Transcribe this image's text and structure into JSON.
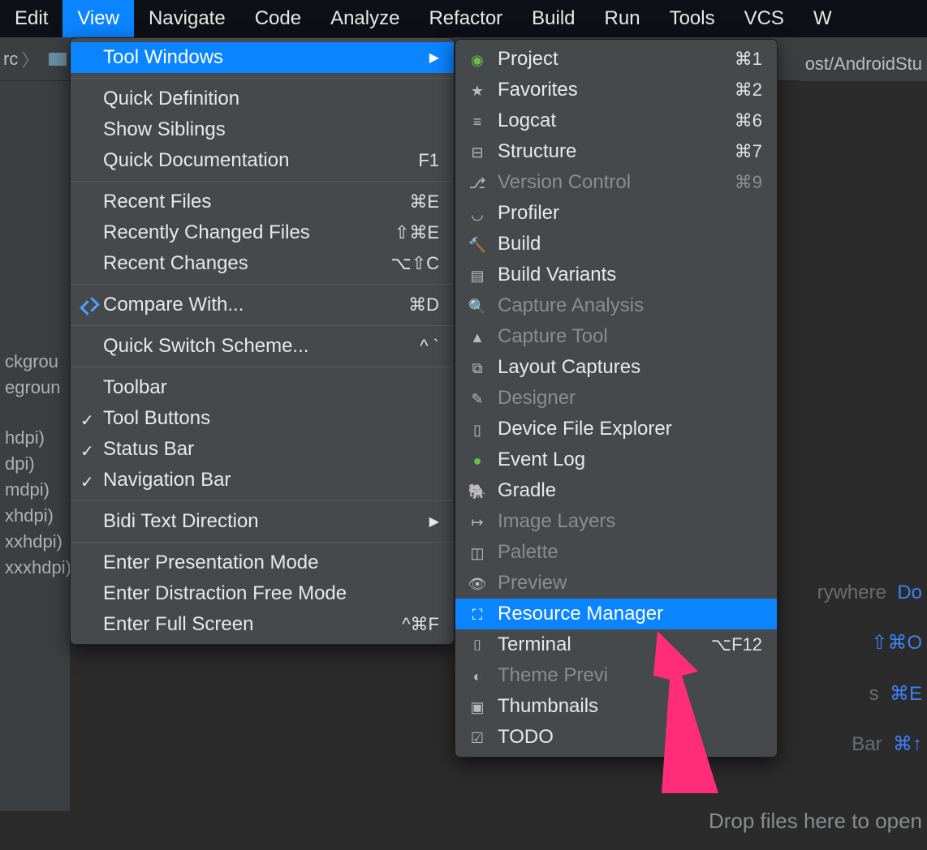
{
  "menubar": {
    "items": [
      "Edit",
      "View",
      "Navigate",
      "Code",
      "Analyze",
      "Refactor",
      "Build",
      "Run",
      "Tools",
      "VCS",
      "W"
    ],
    "active_index": 1
  },
  "breadcrumb": {
    "left": "rc",
    "folder": ""
  },
  "path_right": "ost/AndroidStu",
  "view_menu": {
    "tool_windows": {
      "label": "Tool Windows"
    },
    "quick_definition": {
      "label": "Quick Definition"
    },
    "show_siblings": {
      "label": "Show Siblings"
    },
    "quick_documentation": {
      "label": "Quick Documentation",
      "shortcut": "F1"
    },
    "recent_files": {
      "label": "Recent Files",
      "shortcut": "⌘E"
    },
    "recently_changed_files": {
      "label": "Recently Changed Files",
      "shortcut": "⇧⌘E"
    },
    "recent_changes": {
      "label": "Recent Changes",
      "shortcut": "⌥⇧C"
    },
    "compare_with": {
      "label": "Compare With...",
      "shortcut": "⌘D"
    },
    "quick_switch_scheme": {
      "label": "Quick Switch Scheme...",
      "shortcut": "^ `"
    },
    "toolbar": {
      "label": "Toolbar",
      "checked": false
    },
    "tool_buttons": {
      "label": "Tool Buttons",
      "checked": true
    },
    "status_bar": {
      "label": "Status Bar",
      "checked": true
    },
    "navigation_bar": {
      "label": "Navigation Bar",
      "checked": true
    },
    "bidi": {
      "label": "Bidi Text Direction"
    },
    "enter_presentation": {
      "label": "Enter Presentation Mode"
    },
    "enter_distraction_free": {
      "label": "Enter Distraction Free Mode"
    },
    "enter_full_screen": {
      "label": "Enter Full Screen",
      "shortcut": "^⌘F"
    }
  },
  "tool_windows_menu": {
    "project": {
      "label": "Project",
      "shortcut": "⌘1",
      "icon": "project-icon"
    },
    "favorites": {
      "label": "Favorites",
      "shortcut": "⌘2",
      "icon": "star-icon"
    },
    "logcat": {
      "label": "Logcat",
      "shortcut": "⌘6",
      "icon": "logcat-icon"
    },
    "structure": {
      "label": "Structure",
      "shortcut": "⌘7",
      "icon": "structure-icon"
    },
    "version_control": {
      "label": "Version Control",
      "shortcut": "⌘9",
      "icon": "vcs-icon",
      "disabled": true
    },
    "profiler": {
      "label": "Profiler",
      "icon": "profiler-icon"
    },
    "build": {
      "label": "Build",
      "icon": "hammer-icon"
    },
    "build_variants": {
      "label": "Build Variants",
      "icon": "variants-icon"
    },
    "capture_analysis": {
      "label": "Capture Analysis",
      "icon": "search-icon",
      "disabled": true
    },
    "capture_tool": {
      "label": "Capture Tool",
      "icon": "warning-icon",
      "disabled": true
    },
    "layout_captures": {
      "label": "Layout Captures",
      "icon": "layers-icon"
    },
    "designer": {
      "label": "Designer",
      "icon": "designer-icon",
      "disabled": true
    },
    "device_file_explorer": {
      "label": "Device File Explorer",
      "icon": "device-icon"
    },
    "event_log": {
      "label": "Event Log",
      "icon": "bubble-icon"
    },
    "gradle": {
      "label": "Gradle",
      "icon": "gradle-icon"
    },
    "image_layers": {
      "label": "Image Layers",
      "icon": "image-layers-icon",
      "disabled": true
    },
    "palette": {
      "label": "Palette",
      "icon": "palette-icon",
      "disabled": true
    },
    "preview": {
      "label": "Preview",
      "icon": "eye-icon",
      "disabled": true
    },
    "resource_manager": {
      "label": "Resource Manager",
      "icon": "resource-icon",
      "highlight": true
    },
    "terminal": {
      "label": "Terminal",
      "shortcut": "⌥F12",
      "icon": "terminal-icon"
    },
    "theme_preview": {
      "label": "Theme Previ",
      "icon": "theme-icon",
      "disabled": true
    },
    "thumbnails": {
      "label": "Thumbnails",
      "icon": "thumbnails-icon"
    },
    "todo": {
      "label": "TODO",
      "icon": "todo-icon"
    }
  },
  "background": {
    "sidebar_items": [
      "ckgrou",
      "egroun",
      "",
      "hdpi)",
      "dpi)",
      "mdpi)",
      "xhdpi)",
      "xxhdpi)",
      "xxxhdpi)"
    ],
    "hints": [
      {
        "text": "rywhere",
        "kb": "Do"
      },
      {
        "text": "",
        "kb": "⇧⌘O"
      },
      {
        "text": "s",
        "kb": "⌘E"
      },
      {
        "text": "Bar",
        "kb": "⌘↑"
      }
    ],
    "drop_text": "Drop files here to open"
  }
}
